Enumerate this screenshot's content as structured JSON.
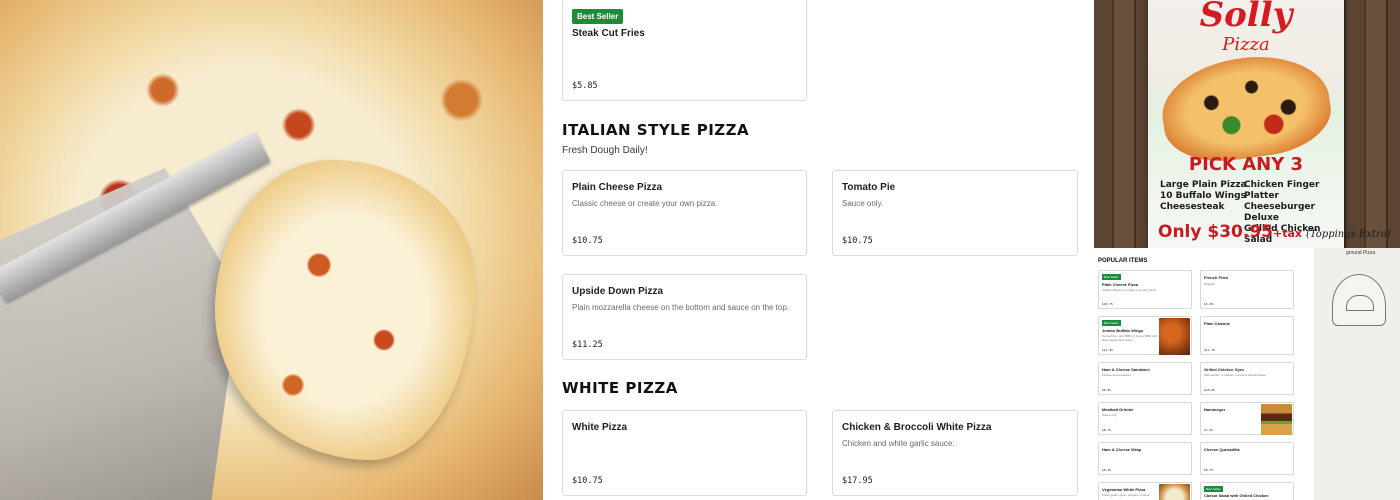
{
  "menu": {
    "top_card": {
      "badge": "Best Seller",
      "name": "Steak Cut Fries",
      "price": "$5.85"
    },
    "sections": [
      {
        "title": "ITALIAN STYLE PIZZA",
        "subtitle": "Fresh Dough Daily!",
        "items": [
          {
            "name": "Plain Cheese Pizza",
            "desc": "Classic cheese or create your own pizza.",
            "price": "$10.75"
          },
          {
            "name": "Tomato Pie",
            "desc": "Sauce only.",
            "price": "$10.75"
          },
          {
            "name": "Upside Down Pizza",
            "desc": "Plain mozzarella cheese on the bottom and sauce on the top.",
            "price": "$11.25"
          }
        ]
      },
      {
        "title": "WHITE PIZZA",
        "subtitle": "",
        "items": [
          {
            "name": "White Pizza",
            "desc": "",
            "price": "$10.75"
          },
          {
            "name": "Chicken & Broccoli White Pizza",
            "desc": "Chicken and white garlic sauce.",
            "price": "$17.95"
          }
        ]
      }
    ]
  },
  "poster": {
    "logo": "Solly",
    "logo_sub": "Pizza",
    "headline": "PICK ANY 3",
    "left_items": [
      "Large Plain Pizza",
      "10 Buffalo Wings",
      "Cheesesteak"
    ],
    "right_items": [
      "Chicken Finger Platter",
      "Cheeseburger Deluxe",
      "Grilled Chicken Salad"
    ],
    "deal_price": "Only $30.95",
    "deal_tax": "+tax",
    "deal_note": "(Toppings Extra)"
  },
  "mini": {
    "heading": "POPULAR ITEMS",
    "brand": "ground Pizza",
    "cards": [
      {
        "badge": "Best Seller",
        "name": "Plain Cheese Pizza",
        "desc": "Classic cheese or create your own pizza.",
        "price": "$10.75"
      },
      {
        "badge": "",
        "name": "French Fries",
        "desc": "Regular.",
        "price": "$5.45"
      },
      {
        "badge": "Best Seller",
        "name": "Jumbo Buffalo Wings",
        "desc": "Served hot, mild, BBQ or honey BBQ with blue cheese and celery.",
        "price": "$12.95"
      },
      {
        "badge": "",
        "name": "Plain Calzone",
        "desc": "",
        "price": "$11.75"
      },
      {
        "badge": "",
        "name": "Ham & Cheese Sandwich",
        "desc": "Lettuce and tomatoes.",
        "price": "$6.95"
      },
      {
        "badge": "",
        "name": "Grilled Chicken Gyro",
        "desc": "With lettuce, tomatoes, onions & tzatziki sauce.",
        "price": "$10.95"
      },
      {
        "badge": "",
        "name": "Meatball Grinder",
        "desc": "Sauce only.",
        "price": "$8.75"
      },
      {
        "badge": "",
        "name": "Hamburger",
        "desc": "",
        "price": "$7.95"
      },
      {
        "badge": "",
        "name": "Ham & Cheese Wrap",
        "desc": "",
        "price": "$8.45"
      },
      {
        "badge": "",
        "name": "Cheese Quesadilla",
        "desc": "",
        "price": "$8.75"
      },
      {
        "badge": "",
        "name": "Vegetarian White Pizza",
        "desc": "Fresh garlic, green peppers, onions",
        "price": ""
      },
      {
        "badge": "Best Seller",
        "name": "Caesar Salad with Grilled Chicken",
        "desc": "",
        "price": ""
      }
    ]
  }
}
